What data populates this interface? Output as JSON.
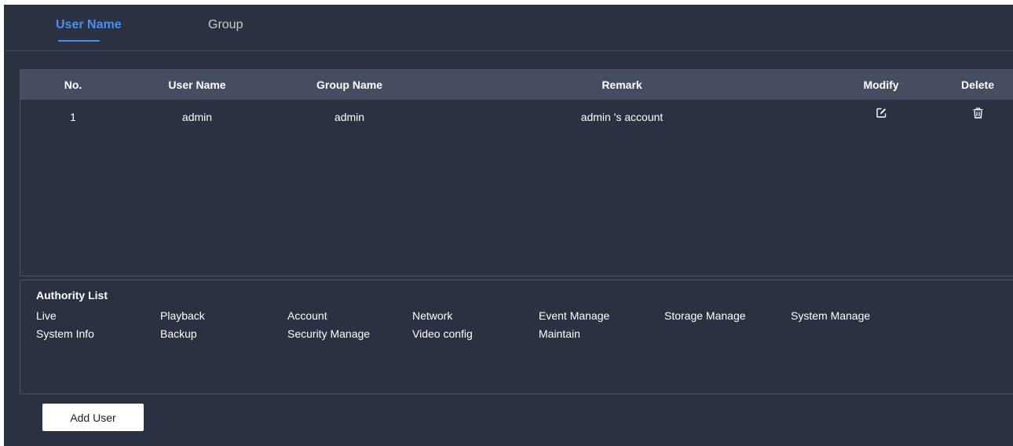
{
  "tabs": {
    "user_name": "User Name",
    "group": "Group"
  },
  "table": {
    "headers": {
      "no": "No.",
      "user_name": "User Name",
      "group_name": "Group Name",
      "remark": "Remark",
      "modify": "Modify",
      "delete": "Delete"
    },
    "rows": [
      {
        "no": "1",
        "user_name": "admin",
        "group_name": "admin",
        "remark": "admin 's account"
      }
    ]
  },
  "authority": {
    "title": "Authority List",
    "items": [
      "Live",
      "Playback",
      "Account",
      "Network",
      "Event Manage",
      "Storage Manage",
      "System Manage",
      "System Info",
      "Backup",
      "Security Manage",
      "Video config",
      "Maintain"
    ]
  },
  "actions": {
    "add_user": "Add User"
  },
  "icons": {
    "modify": "edit-icon",
    "delete": "trash-icon"
  },
  "colors": {
    "background": "#2a3140",
    "header_row": "#454e61",
    "accent": "#4a8ff0"
  }
}
